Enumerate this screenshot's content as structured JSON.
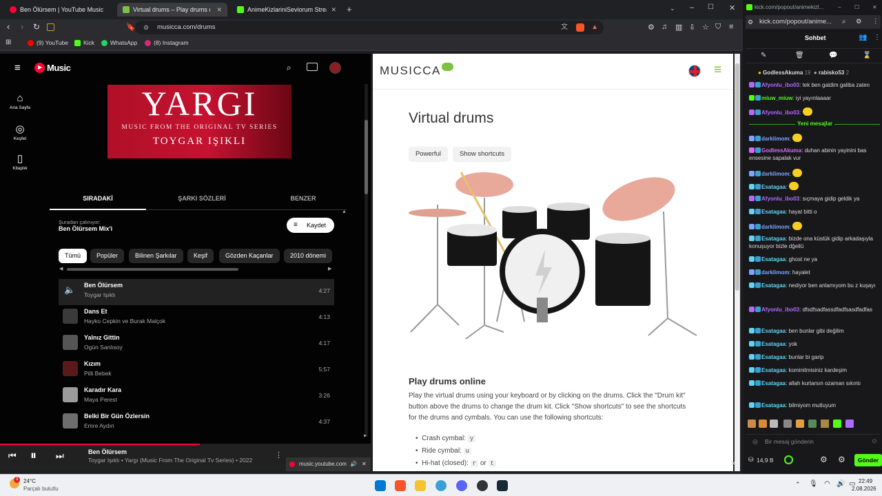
{
  "tabs": [
    {
      "label": "Ben Ölürsem | YouTube Music",
      "active": false
    },
    {
      "label": "Virtual drums – Play drums o",
      "active": true
    },
    {
      "label": "AnimeKizlariniSeviorum Stream - We",
      "active": false
    }
  ],
  "new_tab": "+",
  "address": "musicca.com/drums",
  "bookmarks": [
    {
      "label": "(9) YouTube",
      "color": "#ff0000"
    },
    {
      "label": "Kick",
      "color": "#53fc18"
    },
    {
      "label": "WhatsApp",
      "color": "#25d366"
    },
    {
      "label": "(8) Instagram",
      "color": "#d62976"
    }
  ],
  "ytm": {
    "logo": "Music",
    "nav": [
      "Ana Sayfa",
      "Keşfet",
      "Kitaplık"
    ],
    "album": {
      "title": "YARGI",
      "subtitle": "MUSIC FROM THE ORIGINAL TV SERIES",
      "artist": "TOYGAR IŞIKLI"
    },
    "subtabs": [
      "SIRADAKİ",
      "ŞARKI SÖZLERİ",
      "BENZER"
    ],
    "playing_from_label": "Şuradan çalınıyor:",
    "playing_from": "Ben Ölürsem Mix'i",
    "save": "Kaydet",
    "chips": [
      "Tümü",
      "Popüler",
      "Bilinen Şarkılar",
      "Keşif",
      "Gözden Kaçanlar",
      "2010 dönemi"
    ],
    "queue": [
      {
        "title": "Ben Ölürsem",
        "artist": "Toygar Işıklı",
        "duration": "4:27"
      },
      {
        "title": "Dans Et",
        "artist": "Hayko Cepkin ve Burak Malçok",
        "duration": "4:13"
      },
      {
        "title": "Yalnız Gittin",
        "artist": "Ogün Sanlısoy",
        "duration": "4:17"
      },
      {
        "title": "Kızım",
        "artist": "Pilli Bebek",
        "duration": "5:57"
      },
      {
        "title": "Karadır Kara",
        "artist": "Maya Perest",
        "duration": "3:26"
      },
      {
        "title": "Belki Bir Gün Özlersin",
        "artist": "Emre Aydın",
        "duration": "4:37"
      }
    ],
    "player": {
      "title": "Ben Ölürsem",
      "meta": "Toygar Işıklı • Yargı (Music From The Original Tv Series) • 2022"
    },
    "mini_tab": "music.youtube.com"
  },
  "musicca": {
    "logo": "MUSICCA",
    "title": "Virtual drums",
    "buttons": [
      "Powerful",
      "Show shortcuts"
    ],
    "section_title": "Play drums online",
    "paragraph": "Play the virtual drums using your keyboard or by clicking on the drums. Click the \"Drum kit\" button above the drums to change the drum kit. Click \"Show shortcuts\" to see the shortcuts for the drums and cymbals. You can use the following shortcuts:",
    "shortcuts": [
      {
        "label": "Crash cymbal:",
        "key": "y"
      },
      {
        "label": "Ride cymbal:",
        "key": "u"
      },
      {
        "label": "Hi-hat (closed):",
        "key": "r",
        "or": "or",
        "key2": "t"
      }
    ]
  },
  "kick": {
    "url": "kick.com/popout/animekizl...",
    "url2": "kick.com/popout/anime...",
    "chat_title": "Sohbet",
    "pinned": [
      {
        "user": "GodlessAkuma",
        "count": "19"
      },
      {
        "user": "rabisko53",
        "count": "2"
      }
    ],
    "new_messages": "Yeni mesajlar",
    "messages": [
      {
        "user": "Afyonlu_ibo03",
        "text": "tek ben galdim galiba zaten",
        "color": "#b06aff"
      },
      {
        "user": "miuw_miuw",
        "text": "iyi yayınlaaaar",
        "color": "#53fc18"
      },
      {
        "user": "Afyonlu_ibo03",
        "text": "",
        "color": "#b06aff"
      },
      {
        "user": "darklimom",
        "text": "",
        "color": "#7aa6ff"
      },
      {
        "user": "GodlessAkuma",
        "text": "duhan abinin yayinini bas ensesine sapalak vur",
        "color": "#d66bff"
      },
      {
        "user": "darklimom",
        "text": "",
        "color": "#7aa6ff"
      },
      {
        "user": "Esatagaa",
        "text": "",
        "color": "#5dd6f5"
      },
      {
        "user": "Afyonlu_ibo03",
        "text": "sıçmaya gidip geldik ya",
        "color": "#b06aff"
      },
      {
        "user": "Esatagaa",
        "text": "hayat bitti o",
        "color": "#5dd6f5"
      },
      {
        "user": "darklimom",
        "text": "",
        "color": "#7aa6ff"
      },
      {
        "user": "Esatagaa",
        "text": "bizde ona küstük gidip arkadaşıyla konuşuyor bizle dğeilü",
        "color": "#5dd6f5"
      },
      {
        "user": "Esatagaa",
        "text": "ghost ne ya",
        "color": "#5dd6f5"
      },
      {
        "user": "darklimom",
        "text": "hayalet",
        "color": "#7aa6ff"
      },
      {
        "user": "Esatagaa",
        "text": "nediyor ben anlamıyom bu z kuşayı",
        "color": "#5dd6f5"
      },
      {
        "user": "Afyonlu_ibo03",
        "text": "dfsdfsadfassdfadfsasdfadfas",
        "color": "#b06aff"
      },
      {
        "user": "Esatagaa",
        "text": "ben bunlar gibi değilim",
        "color": "#5dd6f5"
      },
      {
        "user": "Esatagaa",
        "text": "yok",
        "color": "#5dd6f5"
      },
      {
        "user": "Esatagaa",
        "text": "bunlar bi garip",
        "color": "#5dd6f5"
      },
      {
        "user": "Esatagaa",
        "text": "kominitmisiniz kardeşim",
        "color": "#5dd6f5"
      },
      {
        "user": "Esatagaa",
        "text": "allah kurtarsın ozaman sıkıntı",
        "color": "#5dd6f5"
      },
      {
        "user": "Esatagaa",
        "text": "bilmiyom mutluyum",
        "color": "#5dd6f5"
      }
    ],
    "input_placeholder": "Bir mesaj gönderin",
    "points": "14,9 B",
    "send": "Gönder"
  },
  "taskbar": {
    "temp": "24°C",
    "weather": "Parçalı bulutlu",
    "badge": "3",
    "time": "22:49",
    "date": "2.08.2026"
  }
}
